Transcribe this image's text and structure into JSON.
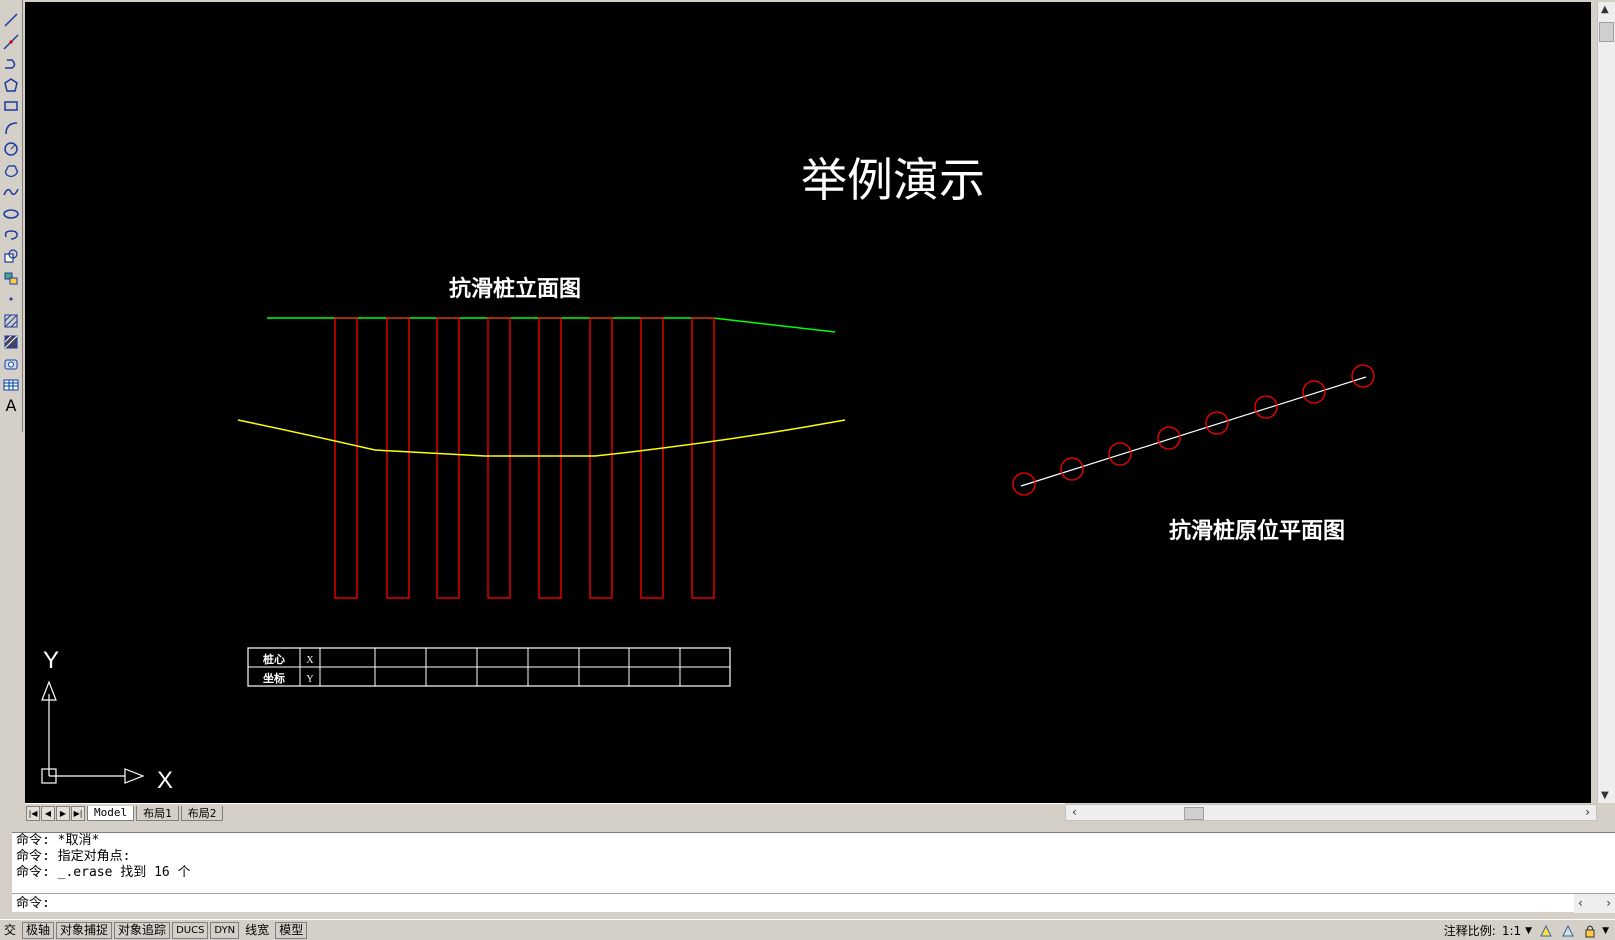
{
  "drawing": {
    "title": "举例演示",
    "elevation_label": "抗滑桩立面图",
    "plan_label": "抗滑桩原位平面图",
    "table_rows": [
      {
        "name": "桩心",
        "axis": "X"
      },
      {
        "name": "坐标",
        "axis": "Y"
      }
    ],
    "ucs_x": "X",
    "ucs_y": "Y",
    "colors": {
      "pile": "#ff0000",
      "ground": "#00ff00",
      "slip": "#ffff00",
      "text": "#ffffff",
      "background": "#000000"
    }
  },
  "toolbar": {
    "tools": [
      "line-icon",
      "construction-line-icon",
      "polyline-icon",
      "polygon-icon",
      "rectangle-icon",
      "arc-icon",
      "circle-icon",
      "revision-cloud-icon",
      "spline-icon",
      "ellipse-icon",
      "ellipse-arc-icon",
      "insert-block-icon",
      "make-block-icon",
      "point-icon",
      "hatch-icon",
      "gradient-icon",
      "region-icon",
      "table-icon",
      "multiline-text-icon"
    ],
    "text_tool_label": "A"
  },
  "tabs": [
    "Model",
    "布局1",
    "布局2"
  ],
  "command": {
    "history": [
      "命令: *取消*",
      "命令: 指定对角点:",
      "命令: _.erase 找到 16 个"
    ],
    "prompt": "命令:"
  },
  "status": {
    "left_stub": "交",
    "buttons": [
      "极轴",
      "对象捕捉",
      "对象追踪",
      "DUCS",
      "DYN",
      "线宽",
      "模型"
    ],
    "annotation_scale_label": "注释比例:",
    "annotation_scale_value": "1:1"
  }
}
